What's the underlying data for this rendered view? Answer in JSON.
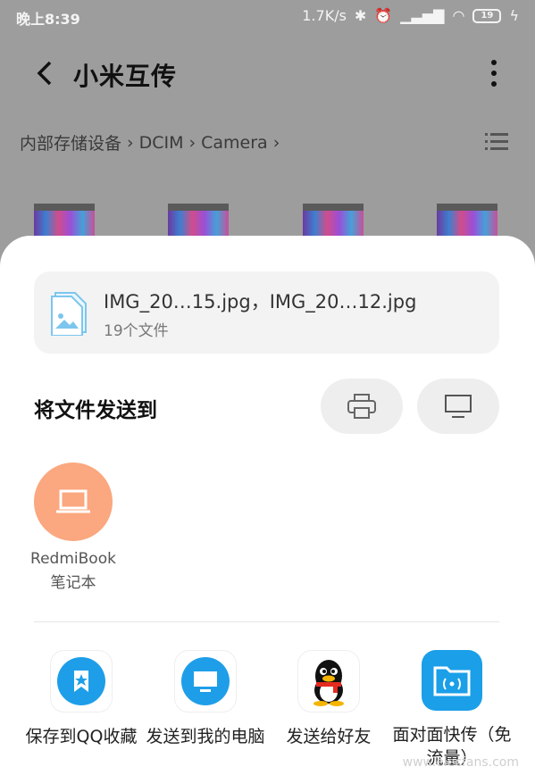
{
  "status": {
    "time": "晚上8:39",
    "speed": "1.7K/s",
    "battery": "19"
  },
  "header": {
    "title": "小米互传"
  },
  "breadcrumb": [
    "内部存储设备",
    "DCIM",
    "Camera"
  ],
  "file": {
    "names": "IMG_20…15.jpg，IMG_20…12.jpg",
    "count": "19个文件"
  },
  "send": {
    "title": "将文件发送到"
  },
  "device": {
    "name": "RedmiBook",
    "type": "笔记本"
  },
  "apps": [
    {
      "label": "保存到QQ收藏",
      "icon": "qq-favorite-icon"
    },
    {
      "label": "发送到我的电脑",
      "icon": "computer-icon"
    },
    {
      "label": "发送给好友",
      "icon": "qq-penguin-icon"
    },
    {
      "label": "面对面快传（免流量）",
      "icon": "face-to-face-transfer-icon"
    }
  ],
  "colors": {
    "device_accent": "#fba77f",
    "app_blue": "#1e9ee8"
  },
  "watermark": "www.elecfans.com"
}
